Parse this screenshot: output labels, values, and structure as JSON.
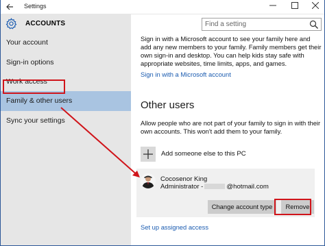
{
  "window": {
    "title": "Settings",
    "back_icon": "arrow-left-icon",
    "controls": [
      "minimize",
      "maximize",
      "close"
    ]
  },
  "sidebar": {
    "header": "ACCOUNTS",
    "header_icon": "gear-icon",
    "items": [
      {
        "label": "Your account",
        "selected": false
      },
      {
        "label": "Sign-in options",
        "selected": false
      },
      {
        "label": "Work access",
        "selected": false
      },
      {
        "label": "Family & other users",
        "selected": true
      },
      {
        "label": "Sync your settings",
        "selected": false
      }
    ]
  },
  "search": {
    "placeholder": "Find a setting",
    "icon": "search-icon"
  },
  "main": {
    "family_text": "Sign in with a Microsoft account to see your family here and add any new members to your family. Family members get their own sign-in and desktop. You can help kids stay safe with appropriate websites, time limits, apps, and games.",
    "family_link": "Sign in with a Microsoft account",
    "other_users_title": "Other users",
    "other_users_text": "Allow people who are not part of your family to sign in with their own accounts. This won't add them to your family.",
    "add_label": "Add someone else to this PC",
    "user": {
      "name": "Cocosenor King",
      "role_prefix": "Administrator -",
      "email_suffix": "@hotmail.com"
    },
    "change_button": "Change account type",
    "remove_button": "Remove",
    "assigned_access_link": "Set up assigned access"
  },
  "colors": {
    "sidebar_bg": "#e6e6e6",
    "selected_bg": "#a9c4e1",
    "link": "#1a5bb0",
    "annotation": "#d0141a",
    "button_bg": "#cccccc"
  }
}
